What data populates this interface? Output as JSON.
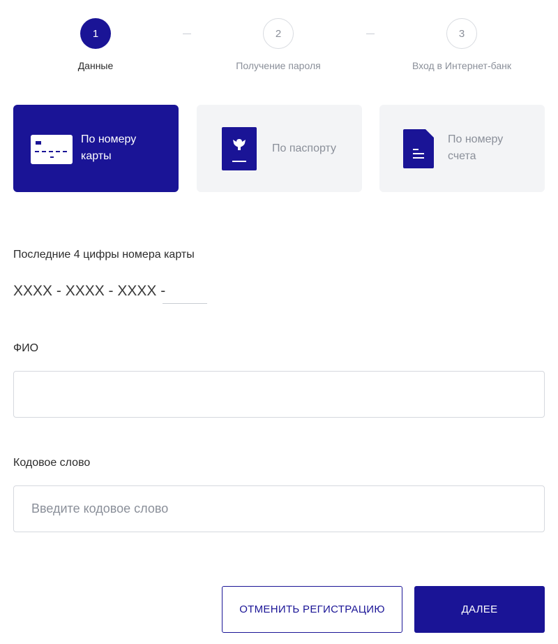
{
  "steps": [
    {
      "number": "1",
      "label": "Данные",
      "state": "active"
    },
    {
      "number": "2",
      "label": "Получение пароля",
      "state": "inactive"
    },
    {
      "number": "3",
      "label": "Вход в Интернет-банк",
      "state": "inactive"
    }
  ],
  "methods": [
    {
      "label": "По номеру\nкарты",
      "icon": "card-icon",
      "selected": true
    },
    {
      "label": "По паспорту",
      "icon": "passport-icon",
      "selected": false
    },
    {
      "label": "По номеру\nсчета",
      "icon": "document-icon",
      "selected": false
    }
  ],
  "card": {
    "label": "Последние 4 цифры номера карты",
    "mask": "XXXX - XXXX - XXXX -",
    "digits_value": ""
  },
  "fio": {
    "label": "ФИО",
    "value": "",
    "placeholder": ""
  },
  "codeword": {
    "label": "Кодовое слово",
    "value": "",
    "placeholder": "Введите кодовое слово"
  },
  "buttons": {
    "cancel": "ОТМЕНИТЬ РЕГИСТРАЦИЮ",
    "next": "ДАЛЕЕ"
  },
  "colors": {
    "primary": "#1a1496",
    "muted": "#8a8f99",
    "tile_bg": "#f3f4f6",
    "border": "#d5d8de"
  }
}
